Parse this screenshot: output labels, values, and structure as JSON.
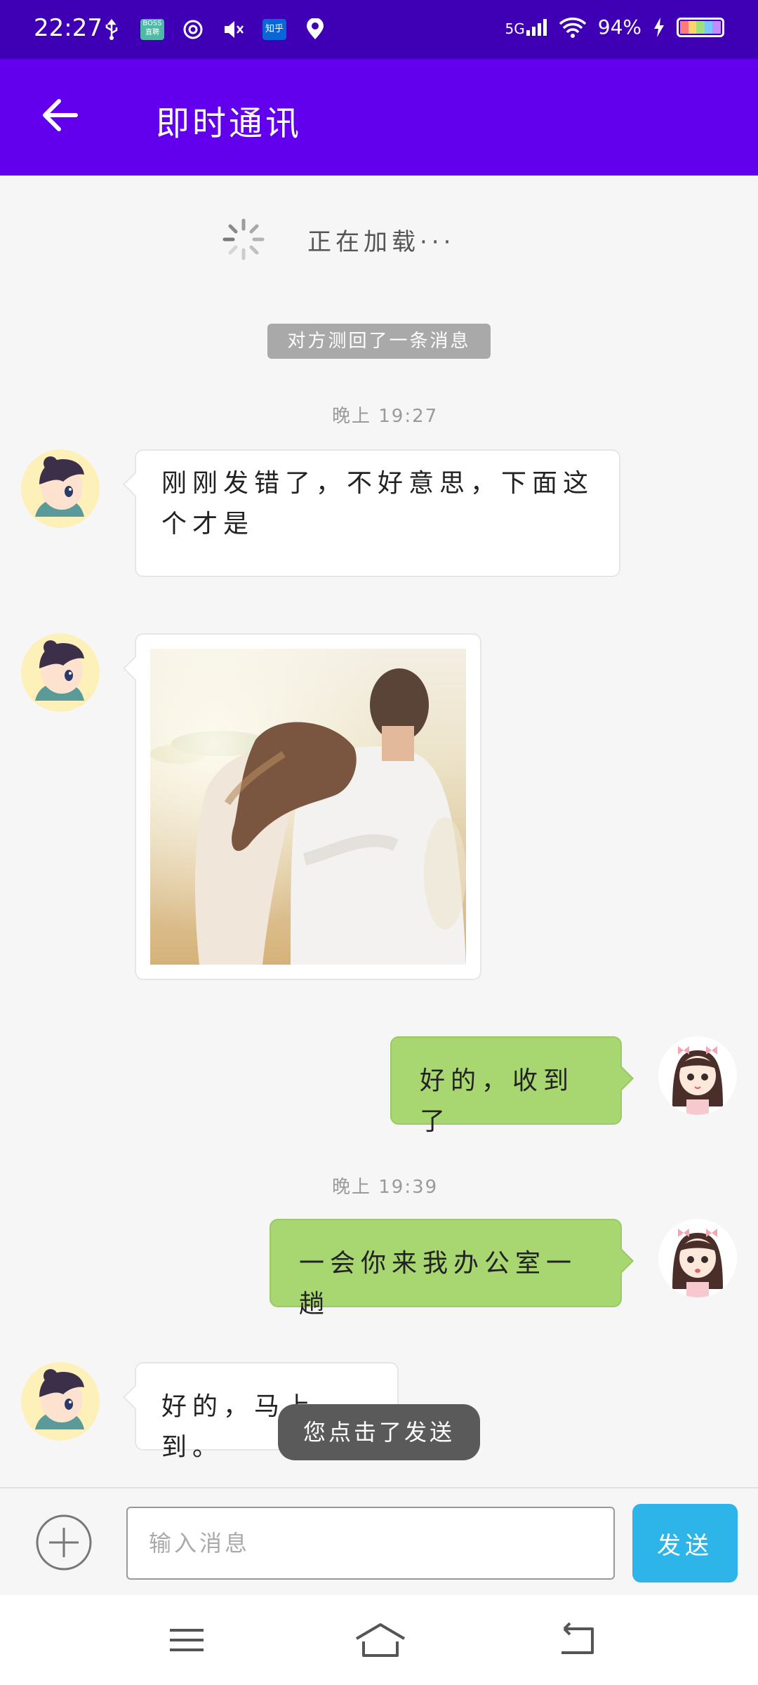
{
  "status_bar": {
    "time": "22:27",
    "network": "5G",
    "battery": "94%",
    "app_icons": [
      "usb-icon",
      "boss-zhipin-icon",
      "netease-music-icon",
      "mute-icon",
      "zhihu-icon",
      "dewu-icon"
    ],
    "boss_label": "BOSS直聘",
    "zhihu_label": "知乎"
  },
  "app_bar": {
    "title": "即时通讯"
  },
  "chat": {
    "loading_text": "正在加载···",
    "recall_notice": "对方测回了一条消息",
    "messages": [
      {
        "time": "晚上 19:27",
        "side": "left",
        "type": "text",
        "text": "刚刚发错了，不好意思，下面这个才是"
      },
      {
        "side": "left",
        "type": "image"
      },
      {
        "side": "right",
        "type": "text",
        "text": "好的，收到了"
      },
      {
        "time": "晚上 19:39",
        "side": "right",
        "type": "text",
        "text": "一会你来我办公室一趟"
      },
      {
        "side": "left",
        "type": "text",
        "text": "好的，马上到。"
      }
    ],
    "toast": "您点击了发送"
  },
  "input_bar": {
    "placeholder": "输入消息",
    "value": "",
    "send_label": "发送"
  },
  "colors": {
    "status_bar": "#3f00b5",
    "app_bar": "#6200ee",
    "bubble_right": "#a8d670",
    "send_button": "#2db4e8"
  }
}
